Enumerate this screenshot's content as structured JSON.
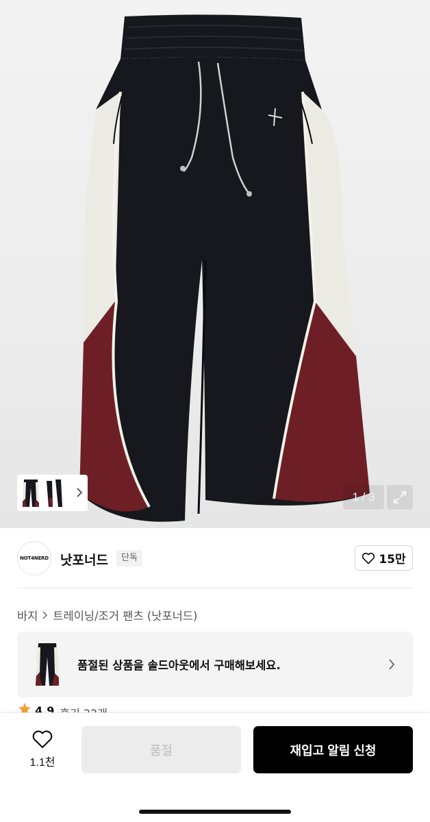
{
  "gallery": {
    "counter": "1 / 3",
    "thumbnail_count": 3,
    "colors": {
      "body": "#15161c",
      "panel": "#ecebe3",
      "accent": "#6e1f26"
    },
    "icons": {
      "thumb_next": "chevron-right-icon",
      "expand": "expand-icon"
    }
  },
  "brand": {
    "logo_text": "NOT4NERD",
    "name": "낫포너드",
    "badge": "단독",
    "likes": "15만",
    "like_icon": "heart-outline-icon"
  },
  "breadcrumb": {
    "category": "바지",
    "separator_icon": "chevron-right-icon",
    "product": "트레이닝/조거 팬츠 (낫포너드)"
  },
  "soldout_banner": {
    "text": "품절된 상품을 솔드아웃에서 구매해보세요.",
    "icon": "chevron-right-icon"
  },
  "rating": {
    "score": "4.9",
    "reviews": "후기 22개",
    "star_color": "#f0a33a"
  },
  "bottom_bar": {
    "wish_count": "1.1천",
    "wish_icon": "heart-outline-icon",
    "soldout_label": "품절",
    "restock_label": "재입고 알림 신청"
  }
}
